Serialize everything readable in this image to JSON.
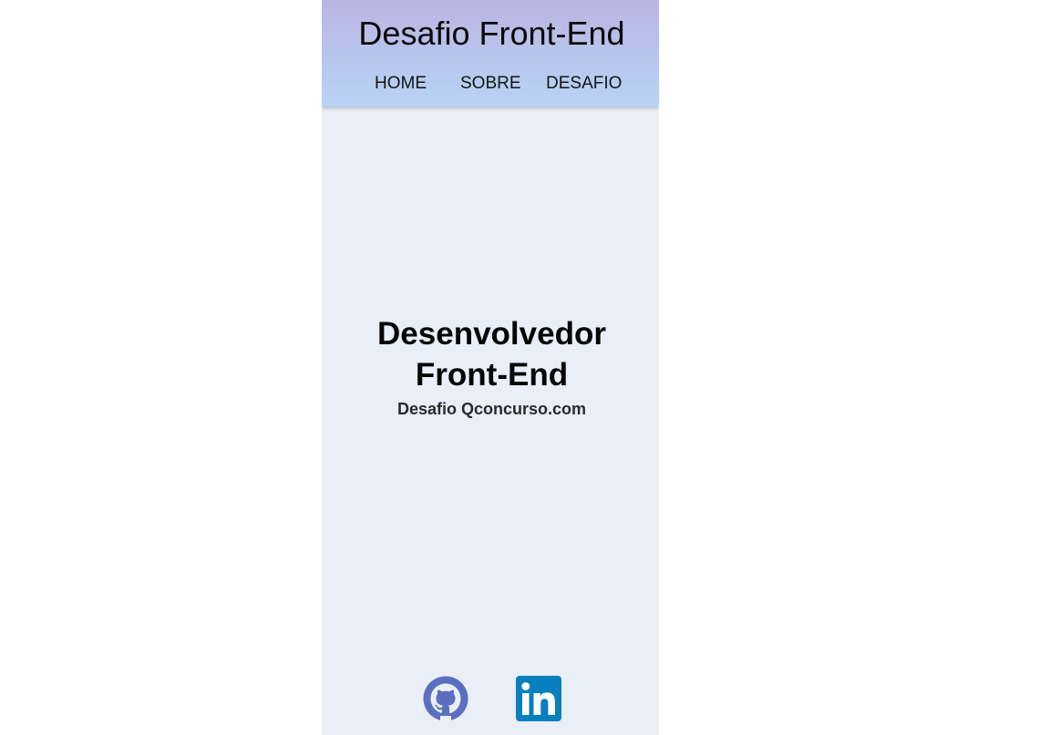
{
  "header": {
    "title": "Desafio Front-End",
    "nav": [
      {
        "label": "HOME"
      },
      {
        "label": "SOBRE"
      },
      {
        "label": "DESAFIO"
      }
    ]
  },
  "hero": {
    "title_line1": "Desenvolvedor",
    "title_line2": "Front-End",
    "subtitle": "Desafio Qconcurso.com"
  },
  "social": {
    "icons": [
      "github-icon",
      "linkedin-icon"
    ]
  },
  "colors": {
    "header_gradient_top": "#b9b5e2",
    "header_gradient_bottom": "#b8d3f5",
    "background": "#eaeef6",
    "github": "#5b6fc1",
    "linkedin": "#0a7fbf"
  }
}
